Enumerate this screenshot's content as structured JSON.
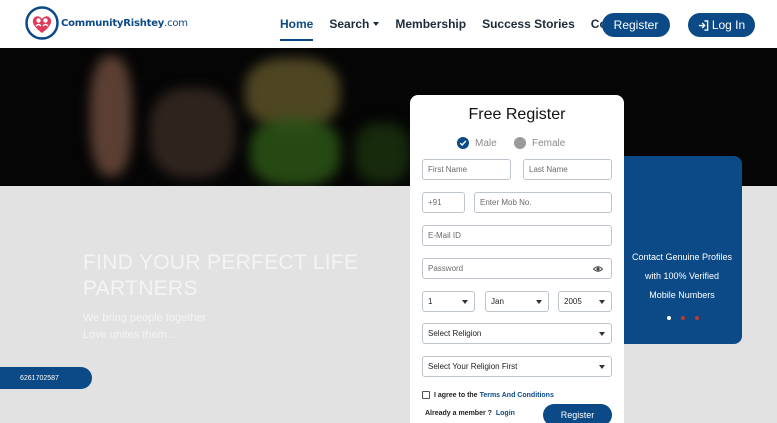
{
  "brand": {
    "name": "CommunityRishtey",
    "tld": ".com",
    "logo_icon": "heart-couple-logo-icon"
  },
  "nav": {
    "items": [
      {
        "label": "Home",
        "active": true
      },
      {
        "label": "Search",
        "active": false,
        "has_caret": true
      },
      {
        "label": "Membership",
        "active": false
      },
      {
        "label": "Success Stories",
        "active": false
      },
      {
        "label": "Contact Us",
        "active": false
      }
    ],
    "register_label": "Register",
    "login_label": "Log In",
    "login_icon": "sign-in-icon"
  },
  "hero": {
    "title": "FIND YOUR PERFECT LIFE PARTNERS",
    "subtitle_line1": "We bring people together",
    "subtitle_line2": "Love unites them...",
    "phone": "6261702587"
  },
  "form": {
    "title": "Free Register",
    "gender_options": [
      "Male",
      "Female"
    ],
    "gender_selected": "Male",
    "first_name_placeholder": "First Name",
    "last_name_placeholder": "Last Name",
    "country_code": "+91",
    "mobile_placeholder": "Enter Mob No.",
    "email_placeholder": "E-Mail ID",
    "password_placeholder": "Password",
    "dob_day": "1",
    "dob_month": "Jan",
    "dob_year": "2005",
    "religion_placeholder": "Select Religion",
    "caste_placeholder": "Select Your Religion First",
    "agree_prefix": "I agree to the",
    "agree_link": "Terms And Conditions",
    "member_prefix": "Already a member ?",
    "member_link": "Login",
    "submit_label": "Register"
  },
  "info_card": {
    "line1": "Contact Genuine Profiles",
    "line2": "with 100% Verified",
    "line3": "Mobile Numbers",
    "dot_colors": [
      "#ffffff",
      "#c0392b",
      "#c0392b"
    ]
  },
  "colors": {
    "primary": "#0b4a86",
    "hero_dark": "#050505",
    "hero_light": "#e2e2e2"
  }
}
